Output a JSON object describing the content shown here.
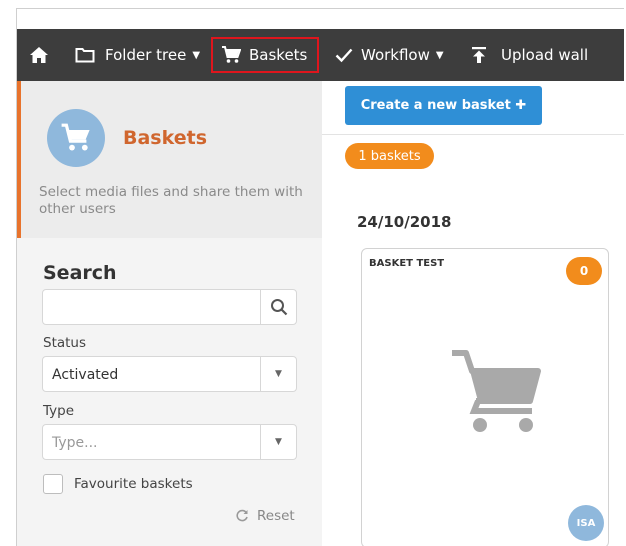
{
  "nav": {
    "folder_tree": "Folder tree",
    "baskets": "Baskets",
    "workflow": "Workflow",
    "upload_wall": "Upload wall"
  },
  "sidebar": {
    "title": "Baskets",
    "description": "Select media files and share them with other users",
    "search_heading": "Search",
    "search_value": "",
    "status_label": "Status",
    "status_value": "Activated",
    "type_label": "Type",
    "type_placeholder": "Type...",
    "favourite_label": "Favourite baskets",
    "reset_label": "Reset"
  },
  "main": {
    "create_label": "Create a new basket ✚",
    "count_label": "1 baskets",
    "date": "24/10/2018",
    "card": {
      "title": "BASKET TEST",
      "count": "0",
      "avatar": "ISA"
    }
  },
  "colors": {
    "nav_bg": "#3d3d3d",
    "accent_orange": "#f28c1c",
    "primary_blue": "#2f8fd6",
    "highlight_red": "#e0161d",
    "title_orange": "#d0662e"
  },
  "icons": [
    "home-icon",
    "folder-icon",
    "cart-icon",
    "check-icon",
    "upload-icon",
    "search-icon",
    "chevron-down-icon",
    "refresh-icon"
  ]
}
